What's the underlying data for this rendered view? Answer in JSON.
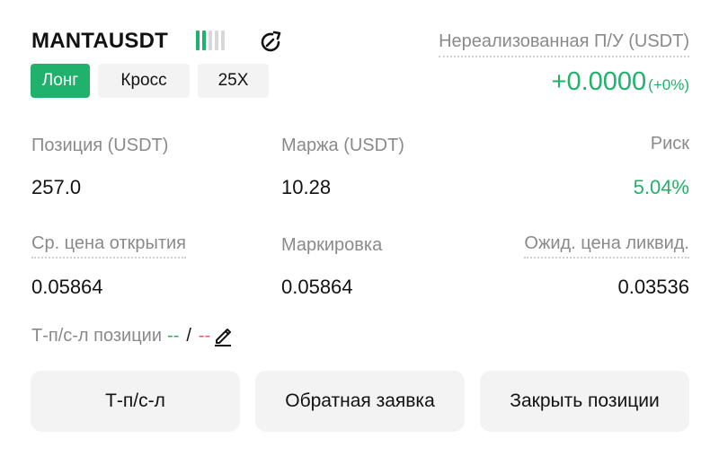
{
  "header": {
    "symbol": "MANTAUSDT",
    "leverage_bars_total": 5,
    "leverage_bars_active": 2,
    "share_icon": "share-refresh-icon"
  },
  "tags": {
    "side": "Лонг",
    "margin_mode": "Кросс",
    "leverage": "25X"
  },
  "unrealized_pnl": {
    "label": "Нереализованная П/У (USDT)",
    "value": "+0.0000",
    "percent": "(+0%)"
  },
  "stats": {
    "position_label": "Позиция (USDT)",
    "position_value": "257.0",
    "margin_label": "Маржа (USDT)",
    "margin_value": "10.28",
    "risk_label": "Риск",
    "risk_value": "5.04%",
    "entry_label": "Ср. цена открытия",
    "entry_value": "0.05864",
    "mark_label": "Маркировка",
    "mark_value": "0.05864",
    "liq_label": "Ожид. цена ликвид.",
    "liq_value": "0.03536"
  },
  "tpsl": {
    "label": "Т-п/с-л позиции",
    "tp_value": "--",
    "separator": "/",
    "sl_value": "--",
    "edit_icon": "pencil-icon"
  },
  "buttons": {
    "tpsl": "Т-п/с-л",
    "reverse": "Обратная заявка",
    "close": "Закрыть позиции"
  },
  "colors": {
    "accent_green": "#20b26c",
    "loss_red": "#e0596b",
    "muted_text": "#8a8a8a",
    "button_bg": "#f3f3f3"
  }
}
